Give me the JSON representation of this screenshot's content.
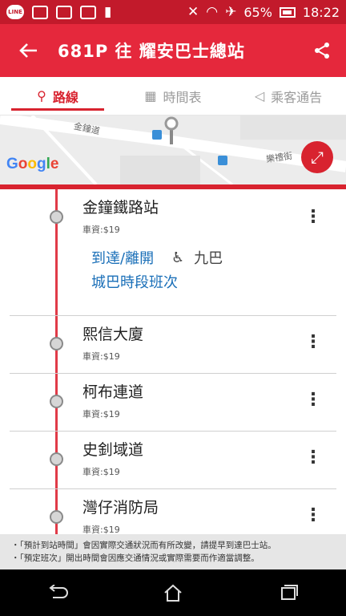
{
  "status_bar": {
    "line_label": "LINE",
    "battery": "65%",
    "time": "18:22"
  },
  "header": {
    "title": "681P 往 耀安巴士總站"
  },
  "tabs": [
    {
      "label": "路線"
    },
    {
      "label": "時間表"
    },
    {
      "label": "乘客通告"
    }
  ],
  "map": {
    "street1": "金鐘道",
    "street2": "樂禮街",
    "google": "Google"
  },
  "stops": [
    {
      "name": "金鐘鐵路站",
      "fare": "車資:$19"
    },
    {
      "name": "熙信大廈",
      "fare": "車資:$19"
    },
    {
      "name": "柯布連道",
      "fare": "車資:$19"
    },
    {
      "name": "史釗域道",
      "fare": "車資:$19"
    },
    {
      "name": "灣仔消防局",
      "fare": "車資:$19"
    }
  ],
  "expanded": {
    "arrive_depart": "到達/離開",
    "operator": "九巴",
    "citybus_schedule": "城巴時段班次"
  },
  "notes": {
    "line1": "・「預計到站時間」會因實際交通狀況而有所改變，請提早到達巴士站。",
    "line2": "・「預定班次」開出時間會因應交通情況或實際需要而作適當調整。"
  },
  "colors": {
    "brand_red": "#e5283c",
    "link_blue": "#1a6fb8"
  }
}
